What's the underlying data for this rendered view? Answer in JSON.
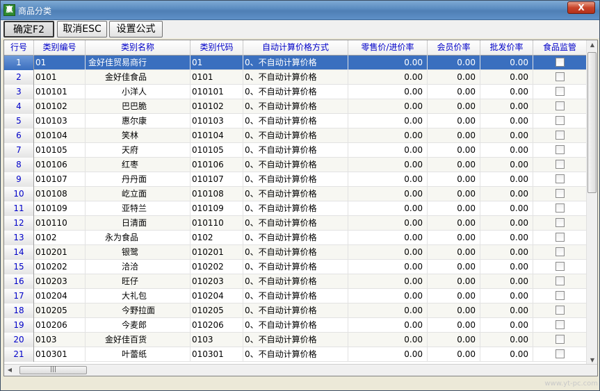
{
  "window": {
    "title": "商品分类",
    "close_label": "X",
    "app_icon": "赢"
  },
  "toolbar": {
    "confirm_label": "确定F2",
    "cancel_label": "取消ESC",
    "formula_label": "设置公式"
  },
  "columns": [
    "行号",
    "类别编号",
    "类别名称",
    "类别代码",
    "自动计算价格方式",
    "零售价/进价率",
    "会员价率",
    "批发价率",
    "食品监管"
  ],
  "rows": [
    {
      "no": "1",
      "code": "01",
      "name": "金好佳贸易商行",
      "abbr": "01",
      "mode": "0、不自动计算价格",
      "retail": "0.00",
      "member": "0.00",
      "wholesale": "0.00",
      "level": 0
    },
    {
      "no": "2",
      "code": "0101",
      "name": "金好佳食品",
      "abbr": "0101",
      "mode": "0、不自动计算价格",
      "retail": "0.00",
      "member": "0.00",
      "wholesale": "0.00",
      "level": 1
    },
    {
      "no": "3",
      "code": "010101",
      "name": "小洋人",
      "abbr": "010101",
      "mode": "0、不自动计算价格",
      "retail": "0.00",
      "member": "0.00",
      "wholesale": "0.00",
      "level": 2
    },
    {
      "no": "4",
      "code": "010102",
      "name": "巴巴脆",
      "abbr": "010102",
      "mode": "0、不自动计算价格",
      "retail": "0.00",
      "member": "0.00",
      "wholesale": "0.00",
      "level": 2
    },
    {
      "no": "5",
      "code": "010103",
      "name": "惠尔康",
      "abbr": "010103",
      "mode": "0、不自动计算价格",
      "retail": "0.00",
      "member": "0.00",
      "wholesale": "0.00",
      "level": 2
    },
    {
      "no": "6",
      "code": "010104",
      "name": "笑林",
      "abbr": "010104",
      "mode": "0、不自动计算价格",
      "retail": "0.00",
      "member": "0.00",
      "wholesale": "0.00",
      "level": 2
    },
    {
      "no": "7",
      "code": "010105",
      "name": "天府",
      "abbr": "010105",
      "mode": "0、不自动计算价格",
      "retail": "0.00",
      "member": "0.00",
      "wholesale": "0.00",
      "level": 2
    },
    {
      "no": "8",
      "code": "010106",
      "name": "红枣",
      "abbr": "010106",
      "mode": "0、不自动计算价格",
      "retail": "0.00",
      "member": "0.00",
      "wholesale": "0.00",
      "level": 2
    },
    {
      "no": "9",
      "code": "010107",
      "name": "丹丹面",
      "abbr": "010107",
      "mode": "0、不自动计算价格",
      "retail": "0.00",
      "member": "0.00",
      "wholesale": "0.00",
      "level": 2
    },
    {
      "no": "10",
      "code": "010108",
      "name": "屹立面",
      "abbr": "010108",
      "mode": "0、不自动计算价格",
      "retail": "0.00",
      "member": "0.00",
      "wholesale": "0.00",
      "level": 2
    },
    {
      "no": "11",
      "code": "010109",
      "name": "亚特兰",
      "abbr": "010109",
      "mode": "0、不自动计算价格",
      "retail": "0.00",
      "member": "0.00",
      "wholesale": "0.00",
      "level": 2
    },
    {
      "no": "12",
      "code": "010110",
      "name": "日清面",
      "abbr": "010110",
      "mode": "0、不自动计算价格",
      "retail": "0.00",
      "member": "0.00",
      "wholesale": "0.00",
      "level": 2
    },
    {
      "no": "13",
      "code": "0102",
      "name": "永为食品",
      "abbr": "0102",
      "mode": "0、不自动计算价格",
      "retail": "0.00",
      "member": "0.00",
      "wholesale": "0.00",
      "level": 1
    },
    {
      "no": "14",
      "code": "010201",
      "name": "银鹭",
      "abbr": "010201",
      "mode": "0、不自动计算价格",
      "retail": "0.00",
      "member": "0.00",
      "wholesale": "0.00",
      "level": 2
    },
    {
      "no": "15",
      "code": "010202",
      "name": "洽洽",
      "abbr": "010202",
      "mode": "0、不自动计算价格",
      "retail": "0.00",
      "member": "0.00",
      "wholesale": "0.00",
      "level": 2
    },
    {
      "no": "16",
      "code": "010203",
      "name": "旺仔",
      "abbr": "010203",
      "mode": "0、不自动计算价格",
      "retail": "0.00",
      "member": "0.00",
      "wholesale": "0.00",
      "level": 2
    },
    {
      "no": "17",
      "code": "010204",
      "name": "大礼包",
      "abbr": "010204",
      "mode": "0、不自动计算价格",
      "retail": "0.00",
      "member": "0.00",
      "wholesale": "0.00",
      "level": 2
    },
    {
      "no": "18",
      "code": "010205",
      "name": "今野拉面",
      "abbr": "010205",
      "mode": "0、不自动计算价格",
      "retail": "0.00",
      "member": "0.00",
      "wholesale": "0.00",
      "level": 2
    },
    {
      "no": "19",
      "code": "010206",
      "name": "今麦郎",
      "abbr": "010206",
      "mode": "0、不自动计算价格",
      "retail": "0.00",
      "member": "0.00",
      "wholesale": "0.00",
      "level": 2
    },
    {
      "no": "20",
      "code": "0103",
      "name": "金好佳百货",
      "abbr": "0103",
      "mode": "0、不自动计算价格",
      "retail": "0.00",
      "member": "0.00",
      "wholesale": "0.00",
      "level": 1
    },
    {
      "no": "21",
      "code": "010301",
      "name": "叶蕾纸",
      "abbr": "010301",
      "mode": "0、不自动计算价格",
      "retail": "0.00",
      "member": "0.00",
      "wholesale": "0.00",
      "level": 2
    }
  ],
  "selected_row": "1",
  "watermark": "www.yt-pc.com",
  "colors": {
    "selected_row": "#3a6fbf",
    "header_text": "#0000c8"
  }
}
